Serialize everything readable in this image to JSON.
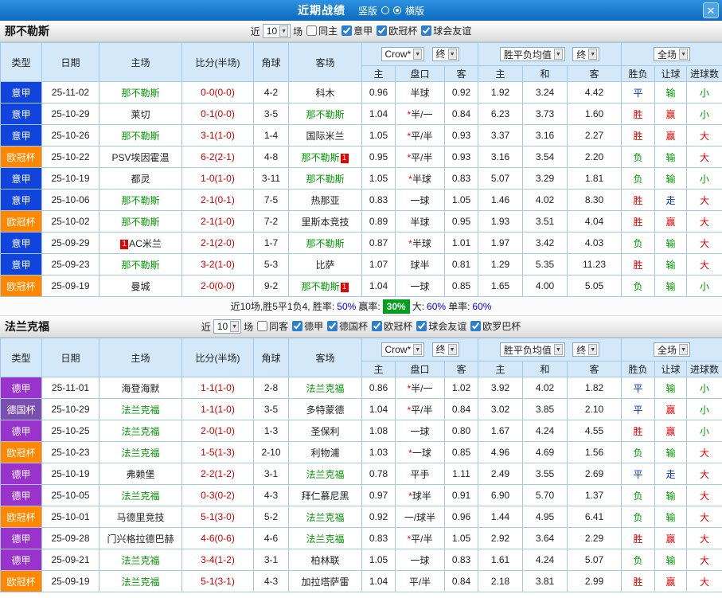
{
  "topbar": {
    "title": "近期战绩",
    "radio_vertical_label": "竖版",
    "radio_horizontal_label": "横版",
    "vertical_selected": false,
    "horizontal_selected": true
  },
  "icons": {
    "dropdown_arrow": "▼",
    "close": "✕"
  },
  "league_colors": {
    "意甲": "#1144dd",
    "欧冠杯": "#ff8800",
    "德甲": "#9933cc",
    "德国杯": "#7a4fb0"
  },
  "table_headers": {
    "type": "类型",
    "date": "日期",
    "home": "主场",
    "score": "比分(半场)",
    "corner": "角球",
    "away": "客场",
    "asian_home": "主",
    "asian_line": "盘口",
    "asian_away": "客",
    "euro_home": "主",
    "euro_draw": "和",
    "euro_away": "客",
    "result": "胜负",
    "handicap": "让球",
    "goals": "进球数",
    "bookmaker": "Crow*",
    "final": "终",
    "euro_avg": "胜平负均值",
    "scope": "全场"
  },
  "sections": [
    {
      "team": "那不勒斯",
      "filter": {
        "near": "近",
        "count": "10",
        "games": "场",
        "checks": [
          {
            "label": "同主",
            "checked": false
          },
          {
            "label": "意甲",
            "checked": true
          },
          {
            "label": "欧冠杯",
            "checked": true
          },
          {
            "label": "球会友谊",
            "checked": true
          }
        ]
      },
      "rows": [
        {
          "type": "意甲",
          "date": "25-11-02",
          "home": "那不勒斯",
          "home_focal": true,
          "away": "科木",
          "score": "0-0(0-0)",
          "corner": "4-2",
          "odds": [
            "0.96",
            "半球",
            "0.92"
          ],
          "europe": [
            "1.92",
            "3.24",
            "4.42"
          ],
          "result": "平",
          "handicap": "输",
          "goals": "小"
        },
        {
          "type": "意甲",
          "date": "25-10-29",
          "home": "莱切",
          "away": "那不勒斯",
          "away_focal": true,
          "score": "0-1(0-0)",
          "corner": "3-5",
          "odds": [
            "1.04",
            "*半/一",
            "0.84"
          ],
          "europe": [
            "6.23",
            "3.73",
            "1.60"
          ],
          "result": "胜",
          "handicap": "赢",
          "goals": "小"
        },
        {
          "type": "意甲",
          "date": "25-10-26",
          "home": "那不勒斯",
          "home_focal": true,
          "away": "国际米兰",
          "score": "3-1(1-0)",
          "corner": "1-4",
          "odds": [
            "1.05",
            "*平/半",
            "0.93"
          ],
          "europe": [
            "3.37",
            "3.16",
            "2.27"
          ],
          "result": "胜",
          "handicap": "赢",
          "goals": "大"
        },
        {
          "type": "欧冠杯",
          "date": "25-10-22",
          "home": "PSV埃因霍温",
          "away": "那不勒斯",
          "away_focal": true,
          "away_badge": "1",
          "away_badge_side": "right",
          "score": "6-2(2-1)",
          "corner": "4-8",
          "odds": [
            "0.95",
            "*平/半",
            "0.93"
          ],
          "europe": [
            "3.16",
            "3.54",
            "2.20"
          ],
          "result": "负",
          "handicap": "输",
          "goals": "大"
        },
        {
          "type": "意甲",
          "date": "25-10-19",
          "home": "都灵",
          "away": "那不勒斯",
          "away_focal": true,
          "score": "1-0(1-0)",
          "corner": "3-11",
          "odds": [
            "1.05",
            "*半球",
            "0.83"
          ],
          "europe": [
            "5.07",
            "3.29",
            "1.81"
          ],
          "result": "负",
          "handicap": "输",
          "goals": "小"
        },
        {
          "type": "意甲",
          "date": "25-10-06",
          "home": "那不勒斯",
          "home_focal": true,
          "away": "热那亚",
          "score": "2-1(0-1)",
          "corner": "7-5",
          "odds": [
            "0.83",
            "一球",
            "1.05"
          ],
          "europe": [
            "1.46",
            "4.02",
            "8.30"
          ],
          "result": "胜",
          "handicap": "走",
          "goals": "大"
        },
        {
          "type": "欧冠杯",
          "date": "25-10-02",
          "home": "那不勒斯",
          "home_focal": true,
          "away": "里斯本竞技",
          "score": "2-1(1-0)",
          "corner": "7-2",
          "odds": [
            "0.89",
            "半球",
            "0.95"
          ],
          "europe": [
            "1.93",
            "3.51",
            "4.04"
          ],
          "result": "胜",
          "handicap": "赢",
          "goals": "大"
        },
        {
          "type": "意甲",
          "date": "25-09-29",
          "home": "AC米兰",
          "home_badge": "1",
          "home_badge_side": "left",
          "away": "那不勒斯",
          "away_focal": true,
          "score": "2-1(2-0)",
          "corner": "1-7",
          "odds": [
            "0.87",
            "*半球",
            "1.01"
          ],
          "europe": [
            "1.97",
            "3.42",
            "4.03"
          ],
          "result": "负",
          "handicap": "输",
          "goals": "大"
        },
        {
          "type": "意甲",
          "date": "25-09-23",
          "home": "那不勒斯",
          "home_focal": true,
          "away": "比萨",
          "score": "3-2(1-0)",
          "corner": "5-3",
          "odds": [
            "1.07",
            "球半",
            "0.81"
          ],
          "europe": [
            "1.29",
            "5.35",
            "11.23"
          ],
          "result": "胜",
          "handicap": "输",
          "goals": "大"
        },
        {
          "type": "欧冠杯",
          "date": "25-09-19",
          "home": "曼城",
          "away": "那不勒斯",
          "away_focal": true,
          "away_badge": "1",
          "away_badge_side": "right",
          "score": "2-0(0-0)",
          "corner": "9-2",
          "odds": [
            "1.04",
            "一球",
            "0.85"
          ],
          "europe": [
            "1.65",
            "4.00",
            "5.05"
          ],
          "result": "负",
          "handicap": "输",
          "goals": "小"
        }
      ],
      "summary": {
        "prefix": "近10场,胜5平1负4, 胜率:",
        "win_rate": "50%",
        "mid1": "赢率:",
        "handicap_rate": "30%",
        "mid2": "大:",
        "big_rate": "60%",
        "mid3": "单率:",
        "single_rate": "60%"
      }
    },
    {
      "team": "法兰克福",
      "filter": {
        "near": "近",
        "count": "10",
        "games": "场",
        "checks": [
          {
            "label": "同客",
            "checked": false
          },
          {
            "label": "德甲",
            "checked": true
          },
          {
            "label": "德国杯",
            "checked": true
          },
          {
            "label": "欧冠杯",
            "checked": true
          },
          {
            "label": "球会友谊",
            "checked": true
          },
          {
            "label": "欧罗巴杯",
            "checked": true
          }
        ]
      },
      "rows": [
        {
          "type": "德甲",
          "date": "25-11-01",
          "home": "海登海默",
          "away": "法兰克福",
          "away_focal": true,
          "score": "1-1(1-0)",
          "corner": "2-8",
          "odds": [
            "0.86",
            "*半/一",
            "1.02"
          ],
          "europe": [
            "3.92",
            "4.02",
            "1.82"
          ],
          "result": "平",
          "handicap": "输",
          "goals": "小"
        },
        {
          "type": "德国杯",
          "date": "25-10-29",
          "home": "法兰克福",
          "home_focal": true,
          "away": "多特蒙德",
          "score": "1-1(1-0)",
          "corner": "3-5",
          "odds": [
            "1.04",
            "*平/半",
            "0.84"
          ],
          "europe": [
            "3.02",
            "3.85",
            "2.10"
          ],
          "result": "平",
          "handicap": "赢",
          "goals": "小"
        },
        {
          "type": "德甲",
          "date": "25-10-25",
          "home": "法兰克福",
          "home_focal": true,
          "away": "圣保利",
          "score": "2-0(1-0)",
          "corner": "1-3",
          "odds": [
            "1.08",
            "一球",
            "0.80"
          ],
          "europe": [
            "1.67",
            "4.24",
            "4.55"
          ],
          "result": "胜",
          "handicap": "赢",
          "goals": "小"
        },
        {
          "type": "欧冠杯",
          "date": "25-10-23",
          "home": "法兰克福",
          "home_focal": true,
          "away": "利物浦",
          "score": "1-5(1-3)",
          "corner": "2-10",
          "odds": [
            "1.03",
            "*一球",
            "0.85"
          ],
          "europe": [
            "4.96",
            "4.69",
            "1.56"
          ],
          "result": "负",
          "handicap": "输",
          "goals": "大"
        },
        {
          "type": "德甲",
          "date": "25-10-19",
          "home": "弗赖堡",
          "away": "法兰克福",
          "away_focal": true,
          "score": "2-2(1-2)",
          "corner": "3-1",
          "odds": [
            "0.78",
            "平手",
            "1.11"
          ],
          "europe": [
            "2.49",
            "3.55",
            "2.69"
          ],
          "result": "平",
          "handicap": "走",
          "goals": "大"
        },
        {
          "type": "德甲",
          "date": "25-10-05",
          "home": "法兰克福",
          "home_focal": true,
          "away": "拜仁慕尼黑",
          "score": "0-3(0-2)",
          "corner": "4-3",
          "odds": [
            "0.97",
            "*球半",
            "0.91"
          ],
          "europe": [
            "6.90",
            "5.70",
            "1.37"
          ],
          "result": "负",
          "handicap": "输",
          "goals": "大"
        },
        {
          "type": "欧冠杯",
          "date": "25-10-01",
          "home": "马德里竞技",
          "away": "法兰克福",
          "away_focal": true,
          "score": "5-1(3-0)",
          "corner": "5-2",
          "odds": [
            "0.92",
            "一/球半",
            "0.96"
          ],
          "europe": [
            "1.44",
            "4.95",
            "6.41"
          ],
          "result": "负",
          "handicap": "输",
          "goals": "大"
        },
        {
          "type": "德甲",
          "date": "25-09-28",
          "home": "门兴格拉德巴赫",
          "away": "法兰克福",
          "away_focal": true,
          "score": "4-6(0-6)",
          "corner": "4-6",
          "odds": [
            "0.83",
            "*平/半",
            "1.05"
          ],
          "europe": [
            "2.92",
            "3.64",
            "2.29"
          ],
          "result": "胜",
          "handicap": "赢",
          "goals": "大"
        },
        {
          "type": "德甲",
          "date": "25-09-21",
          "home": "法兰克福",
          "home_focal": true,
          "away": "柏林联",
          "score": "3-4(1-2)",
          "corner": "3-1",
          "odds": [
            "1.05",
            "一球",
            "0.83"
          ],
          "europe": [
            "1.61",
            "4.24",
            "5.07"
          ],
          "result": "负",
          "handicap": "输",
          "goals": "大"
        },
        {
          "type": "欧冠杯",
          "date": "25-09-19",
          "home": "法兰克福",
          "home_focal": true,
          "away": "加拉塔萨雷",
          "score": "5-1(3-1)",
          "corner": "4-3",
          "odds": [
            "1.04",
            "平/半",
            "0.84"
          ],
          "europe": [
            "2.18",
            "3.81",
            "2.99"
          ],
          "result": "胜",
          "handicap": "赢",
          "goals": "大"
        }
      ]
    }
  ]
}
